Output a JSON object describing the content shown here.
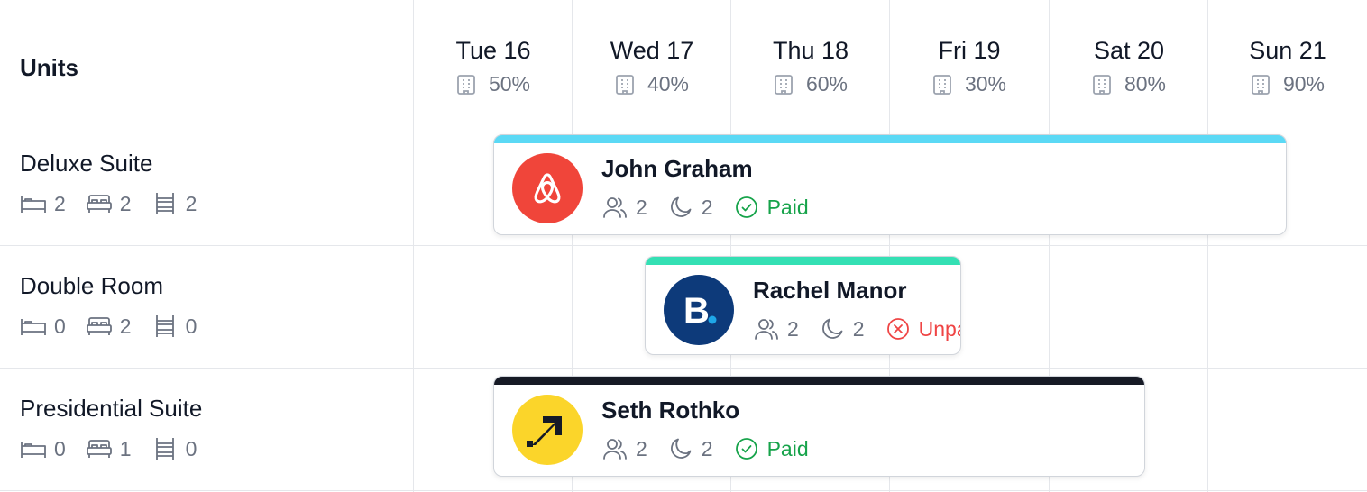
{
  "header": {
    "units_label": "Units"
  },
  "days": [
    {
      "label": "Tue 16",
      "occupancy": "50%"
    },
    {
      "label": "Wed 17",
      "occupancy": "40%"
    },
    {
      "label": "Thu 18",
      "occupancy": "60%"
    },
    {
      "label": "Fri 19",
      "occupancy": "30%"
    },
    {
      "label": "Sat 20",
      "occupancy": "80%"
    },
    {
      "label": "Sun 21",
      "occupancy": "90%"
    }
  ],
  "units": [
    {
      "name": "Deluxe Suite",
      "single_beds": "2",
      "double_beds": "2",
      "bunk_beds": "2"
    },
    {
      "name": "Double Room",
      "single_beds": "0",
      "double_beds": "2",
      "bunk_beds": "0"
    },
    {
      "name": "Presidential Suite",
      "single_beds": "0",
      "double_beds": "1",
      "bunk_beds": "0"
    }
  ],
  "bookings": [
    {
      "guest": "John Graham",
      "source_icon": "airbnb-logo",
      "guests": "2",
      "nights": "2",
      "payment": "Paid",
      "bar_color": "#5bd9f5"
    },
    {
      "guest": "Rachel Manor",
      "source_icon": "booking-logo",
      "guests": "2",
      "nights": "2",
      "payment": "Unpaid",
      "bar_color": "#34e0b4"
    },
    {
      "guest": "Seth Rothko",
      "source_icon": "expedia-logo",
      "guests": "2",
      "nights": "2",
      "payment": "Paid",
      "bar_color": "#161a25"
    }
  ]
}
